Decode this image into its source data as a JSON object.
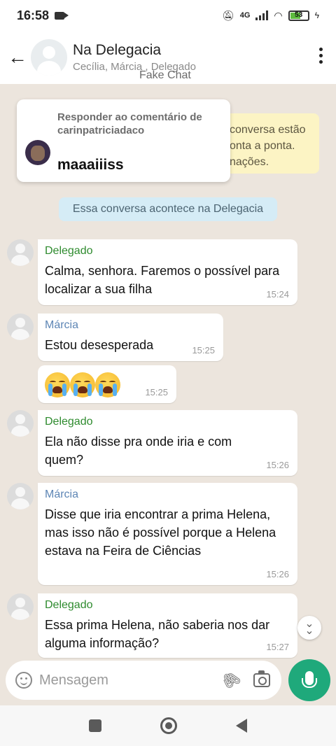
{
  "status_bar": {
    "time": "16:58",
    "network": "4G",
    "battery": "53"
  },
  "header": {
    "title": "Na Delegacia",
    "subtitle": "Cecília, Márcia , Delegado"
  },
  "watermark": "Fake Chat",
  "encryption_notice": {
    "line1": "conversa estão",
    "line2": "onta a ponta.",
    "line3": "nações."
  },
  "reply_card": {
    "header": "Responder ao comentário de carinpatriciadaco",
    "comment": "maaaiiiss"
  },
  "system_message": "Essa conversa acontece na Delegacia",
  "messages": [
    {
      "sender": "Delegado",
      "text": "Calma, senhora. Faremos o possível para localizar a sua filha",
      "time": "15:24"
    },
    {
      "sender": "Márcia",
      "text": "Estou desesperada",
      "time": "15:25"
    },
    {
      "sender": "",
      "text": "😭😭😭",
      "time": "15:25"
    },
    {
      "sender": "Delegado",
      "text": "Ela não disse pra onde iria e com quem?",
      "time": "15:26"
    },
    {
      "sender": "Márcia",
      "text": "Disse que iria encontrar a prima Helena, mas isso não é possível porque a Helena estava na Feira de Ciências",
      "time": "15:26"
    },
    {
      "sender": "Delegado",
      "text": "Essa prima Helena, não saberia nos dar alguma informação?",
      "time": "15:27"
    }
  ],
  "input": {
    "placeholder": "Mensagem"
  },
  "colors": {
    "chat_background": "#ece5dd",
    "sender_delegado": "#2e8b2e",
    "sender_marcia": "#5e86b5",
    "mic_button": "#1fa97b",
    "encryption_notice": "#fcf4c4",
    "system_message": "#d5ecf6"
  },
  "icons": [
    "back-arrow-icon",
    "more-vert-icon",
    "emoji-icon",
    "attach-icon",
    "camera-icon",
    "mic-icon",
    "scroll-down-icon"
  ]
}
